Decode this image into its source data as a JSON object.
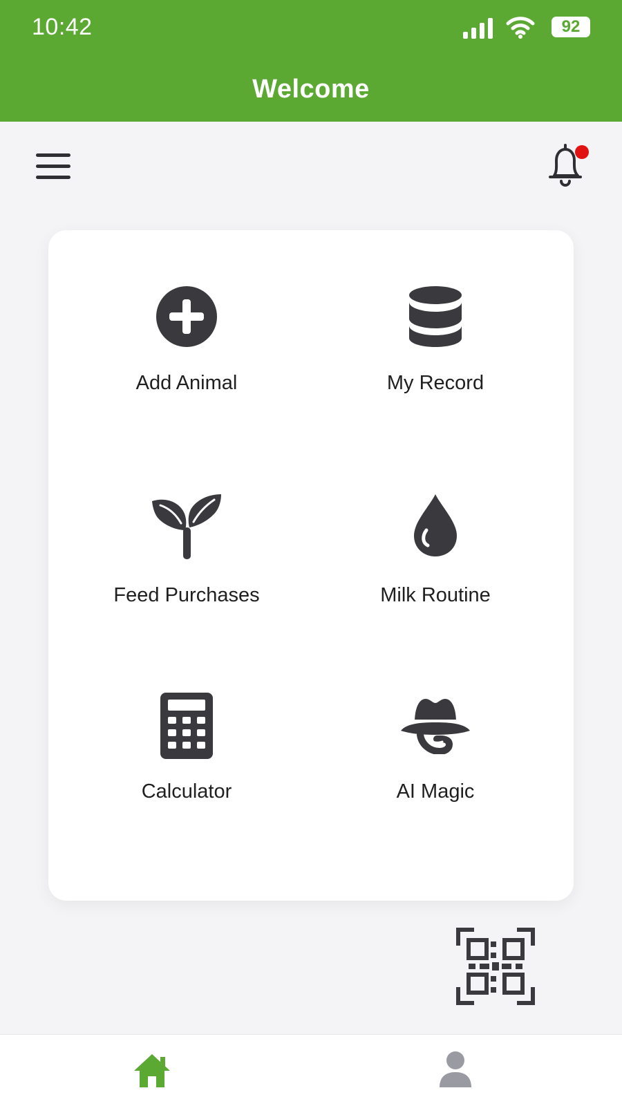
{
  "status_bar": {
    "time": "10:42",
    "battery": "92",
    "signal_icon": "cellular-signal-icon",
    "wifi_icon": "wifi-icon"
  },
  "header": {
    "title": "Welcome",
    "background_color": "#5ba833"
  },
  "toolbar": {
    "menu_icon": "hamburger-menu-icon",
    "notification_icon": "bell-icon",
    "notification_badge_color": "#e01212"
  },
  "menu_grid": [
    {
      "label": "Add Animal",
      "icon": "plus-circle-icon"
    },
    {
      "label": "My Record",
      "icon": "database-icon"
    },
    {
      "label": "Feed Purchases",
      "icon": "sprout-icon"
    },
    {
      "label": "Milk Routine",
      "icon": "water-drop-icon"
    },
    {
      "label": "Calculator",
      "icon": "calculator-icon"
    },
    {
      "label": "AI Magic",
      "icon": "incognito-hat-icon"
    }
  ],
  "scan": {
    "icon": "qr-scan-icon"
  },
  "bottom_nav": {
    "items": [
      {
        "icon": "home-icon",
        "active": true,
        "color": "#5ba833"
      },
      {
        "icon": "profile-icon",
        "active": false,
        "color": "#9a9aa2"
      }
    ]
  }
}
